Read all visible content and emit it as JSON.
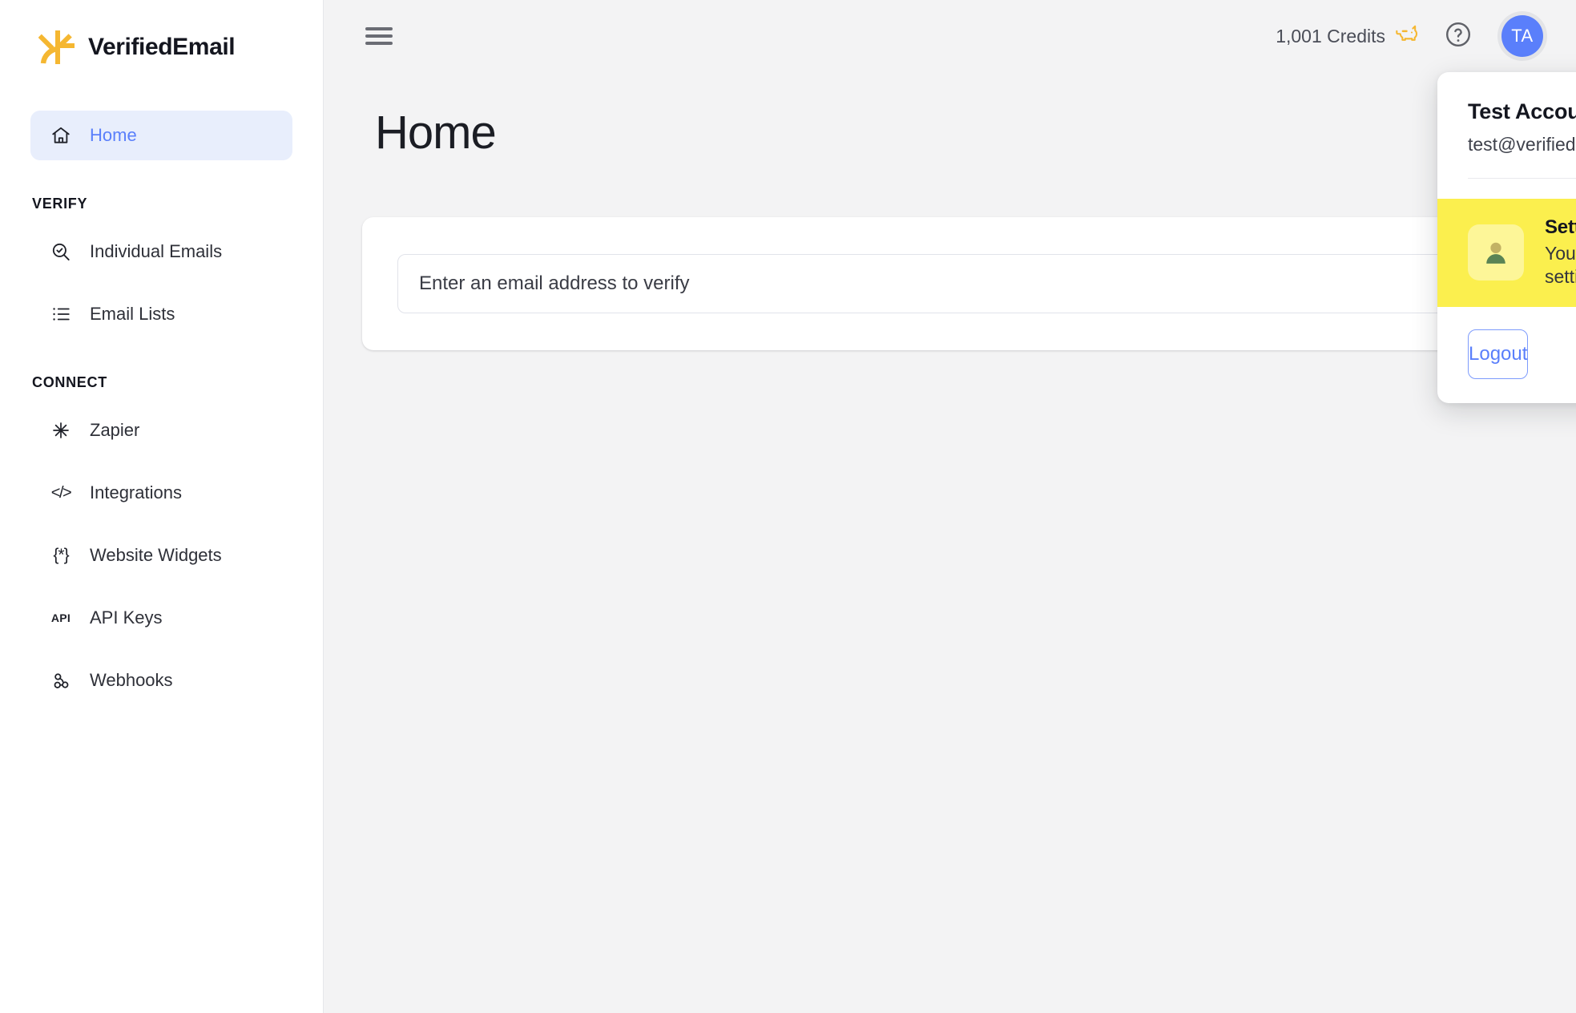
{
  "brand": {
    "name": "VerifiedEmail",
    "logo_icon": "starburst-logo-icon",
    "logo_color": "#f5b731"
  },
  "sidebar": {
    "primary": [
      {
        "label": "Home",
        "icon": "home-icon",
        "active": true
      }
    ],
    "sections": [
      {
        "title": "VERIFY",
        "items": [
          {
            "label": "Individual Emails",
            "icon": "search-check-icon"
          },
          {
            "label": "Email Lists",
            "icon": "list-icon"
          }
        ]
      },
      {
        "title": "CONNECT",
        "items": [
          {
            "label": "Zapier",
            "icon": "zapier-asterisk-icon"
          },
          {
            "label": "Integrations",
            "icon": "code-brackets-icon"
          },
          {
            "label": "Website Widgets",
            "icon": "curly-brace-star-icon"
          },
          {
            "label": "API Keys",
            "icon": "api-text-icon"
          },
          {
            "label": "Webhooks",
            "icon": "webhook-icon"
          }
        ]
      }
    ]
  },
  "topbar": {
    "menu_toggle_icon": "hamburger-icon",
    "credits_label": "1,001 Credits",
    "credits_icon": "piggy-bank-icon",
    "help_icon": "question-circle-icon",
    "avatar_initials": "TA"
  },
  "main": {
    "page_title": "Home",
    "verify_input_placeholder": "Enter an email address to verify",
    "verify_input_value": ""
  },
  "user_menu": {
    "account_name": "Test Account",
    "account_email": "test@verified.email",
    "settings_title": "Settings",
    "settings_subtitle": "Your password and notification settings",
    "settings_icon": "person-avatar-icon",
    "settings_highlight_color": "#fbef4e",
    "logout_label": "Logout",
    "logout_color": "#5a7ffb"
  },
  "colors": {
    "accent_blue": "#5a7ffb",
    "brand_yellow": "#f5b731",
    "highlight_yellow": "#fbef4e",
    "page_background": "#f3f3f4",
    "panel_background": "#ffffff"
  }
}
